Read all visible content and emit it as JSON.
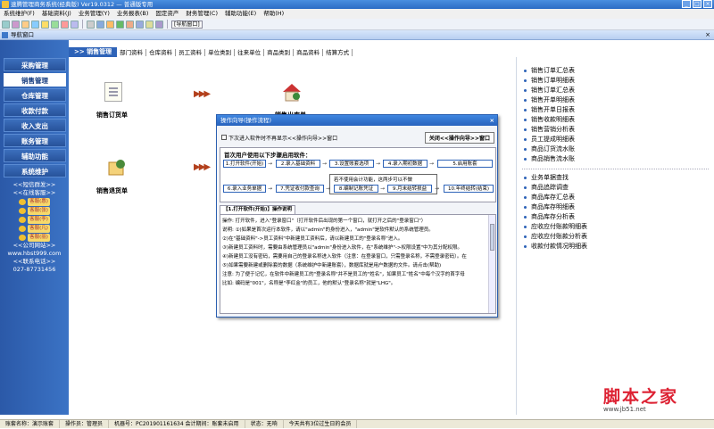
{
  "window": {
    "title": "速腾管理商务系统(经典版)  Ver19.0312 — 普通版专用"
  },
  "menu": [
    "系统维护(F)",
    "基础资料(J)",
    "业务管理(Y)",
    "业务报表(B)",
    "固定资产",
    "财务管理(C)",
    "辅助功能(E)",
    "帮助(H)"
  ],
  "toolbar": {
    "exit_label": "[导航窗口]"
  },
  "inner_window": {
    "title": "导航窗口",
    "close": "×"
  },
  "sidebar": {
    "items": [
      "采购管理",
      "销售管理",
      "仓库管理",
      "收款付款",
      "收入支出",
      "账务管理",
      "辅助功能",
      "系统维护"
    ],
    "active": 1,
    "sms": "<<短信群发>>",
    "online": "<<在线客服>>",
    "cs": [
      "客服(惠)",
      "客服(张)",
      "客服(李)",
      "客服(凡)",
      "客服(丽)"
    ],
    "website_label": "<<公司网站>>",
    "website": "www.hbst999.com",
    "phone_label": "<<联系电话>>",
    "phone": "027-87731456"
  },
  "tabs": {
    "active": ">> 销售管理",
    "items": [
      "部门资料",
      "仓库资料",
      "员工资料",
      "单位类别",
      "往来单位",
      "商品类别",
      "商品资料",
      "结算方式"
    ]
  },
  "main": {
    "order_label": "销售订货单",
    "out_label": "销售出库单",
    "return_label": "销售退货单",
    "arrow1": "▶▶▶",
    "arrow2": "▶▶▶"
  },
  "right_panel": {
    "group1": [
      "销售订单汇总表",
      "销售订单明细表",
      "销售订单汇总表",
      "销售开单明细表",
      "销售开单日报表",
      "销售收款明细表",
      "销售营销分析表",
      "员工提成明细表",
      "商品订货流水账",
      "商品销售流水账"
    ],
    "group2": [
      "业务单据查找",
      "商品追踪调查",
      "商品库存汇总表",
      "商品库存明细表",
      "商品库存分析表",
      "应收应付账款明细表",
      "应收应付账款分析表",
      "收款付款情况明细表"
    ]
  },
  "dialog": {
    "title": "操作向导(操作流程)",
    "close": "×",
    "checkbox": "下次进入软件时不再显示<<操作向导>>窗口",
    "close_button": "关闭<<操作向导>>窗口",
    "flow_title": "首次用户使用以下步骤启用软件：",
    "steps_row1": [
      "1.打开软件(开始)",
      "2.录入基础资料",
      "3.设置账套选项",
      "4.录入期初数据",
      "5.启用账套"
    ],
    "steps_row2": [
      "6.录入业务单据",
      "7.凭证收付款查询",
      "8.编制记账凭证",
      "9.月末结转损益",
      "10.年终结转(结束)"
    ],
    "note": "若不使用会计功能，这两步可以不做",
    "tab": "【1.打开软件(开始)】操作说明",
    "text_lines": [
      "操作: 打开软件，进入\"登录窗口\"（打开软件后出现的第一个窗口，就打开之后的\"登录窗口\"）",
      "说明:  ①)如果是首次运行本软件，请以\"admin\"的身份进入，\"admin\"是软件默认的系统管理员。",
      "        ②)在\"基础资料\"->员工资料\"中新建员工资料后，请以新建员工的\"登录名称\"进入。",
      "        ③)新建员工资料时，需要由系统管理员以\"admin\"身份进入软件，在\"系统维护\"->权限设置\"中为其分配权限。",
      "        ④)新建员工没有密码，需要用自己的登录名称进入软件（注意：在登录窗口，只需登录名称，不需登录密码）。在",
      "        ⑤)如果需要新建或删除套的数据（系统维护中新建账套），数据库就是用户数据的文件。请点击(帮助)",
      "注意:  为了便于记忆，在软件中新建员工的\"登录名称\"并不是员工的\"姓名\"，如果员工\"姓名\"中每个汉字的首字母",
      "        比如: 编码是\"001\"，名称是\"李红金\"的员工，他的默认\"登录名称\"就是\"LHG\"。"
    ]
  },
  "status": [
    "账套名称：演示账套",
    "操作员：管理员",
    "机器号：PC201901161634 会计期间：账套未启用",
    "状态：无响",
    "今天共有3位过生日的会员"
  ],
  "watermark": {
    "line1": "脚本之家",
    "line2": "www.jb51.net"
  }
}
